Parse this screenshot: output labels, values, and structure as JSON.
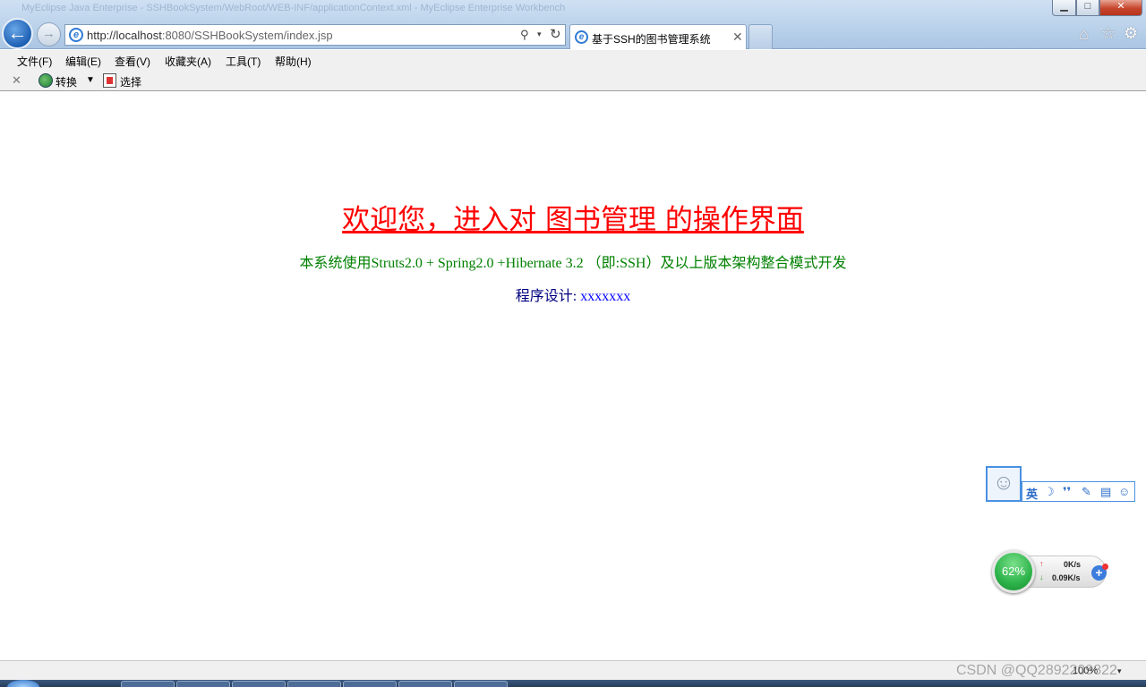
{
  "window": {
    "title": "MyEclipse Java Enterprise - SSHBookSystem/WebRoot/WEB-INF/applicationContext.xml - MyEclipse Enterprise Workbench",
    "minimize": "▁",
    "maximize": "□",
    "close": "✕"
  },
  "nav": {
    "back": "←",
    "forward": "→",
    "url_host": "http://localhost",
    "url_rest": ":8080/SSHBookSystem/index.jsp",
    "search": "⚲",
    "dropdown": "▾",
    "refresh": "↻"
  },
  "tab": {
    "title": "基于SSH的图书管理系统",
    "close": "✕"
  },
  "toolbar_icons": {
    "home": "⌂",
    "favorites": "☆",
    "tools": "⚙"
  },
  "menu": [
    "文件(F)",
    "编辑(E)",
    "查看(V)",
    "收藏夹(A)",
    "工具(T)",
    "帮助(H)"
  ],
  "commandbar": {
    "close": "✕",
    "convert": "转换",
    "dropdown": "▼",
    "select": "选择"
  },
  "page": {
    "welcome": "欢迎您，进入对 图书管理 的操作界面",
    "desc": "本系统使用Struts2.0 + Spring2.0 +Hibernate 3.2 （即:SSH）及以上版本架构整合模式开发",
    "design_label": "程序设计: ",
    "design_value": "xxxxxxx"
  },
  "ime": {
    "avatar": "☺",
    "buttons": [
      "英",
      "☽",
      "❜❜",
      "✎",
      "▤",
      "☺"
    ]
  },
  "netmon": {
    "percent": "62%",
    "up": "0K/s",
    "down": "0.09K/s",
    "up_arrow": "↑",
    "down_arrow": "↓",
    "plus": "+"
  },
  "status": {
    "zoom": "100%",
    "zoom_drop": "▾",
    "watermark": "CSDN @QQ2892209822"
  }
}
